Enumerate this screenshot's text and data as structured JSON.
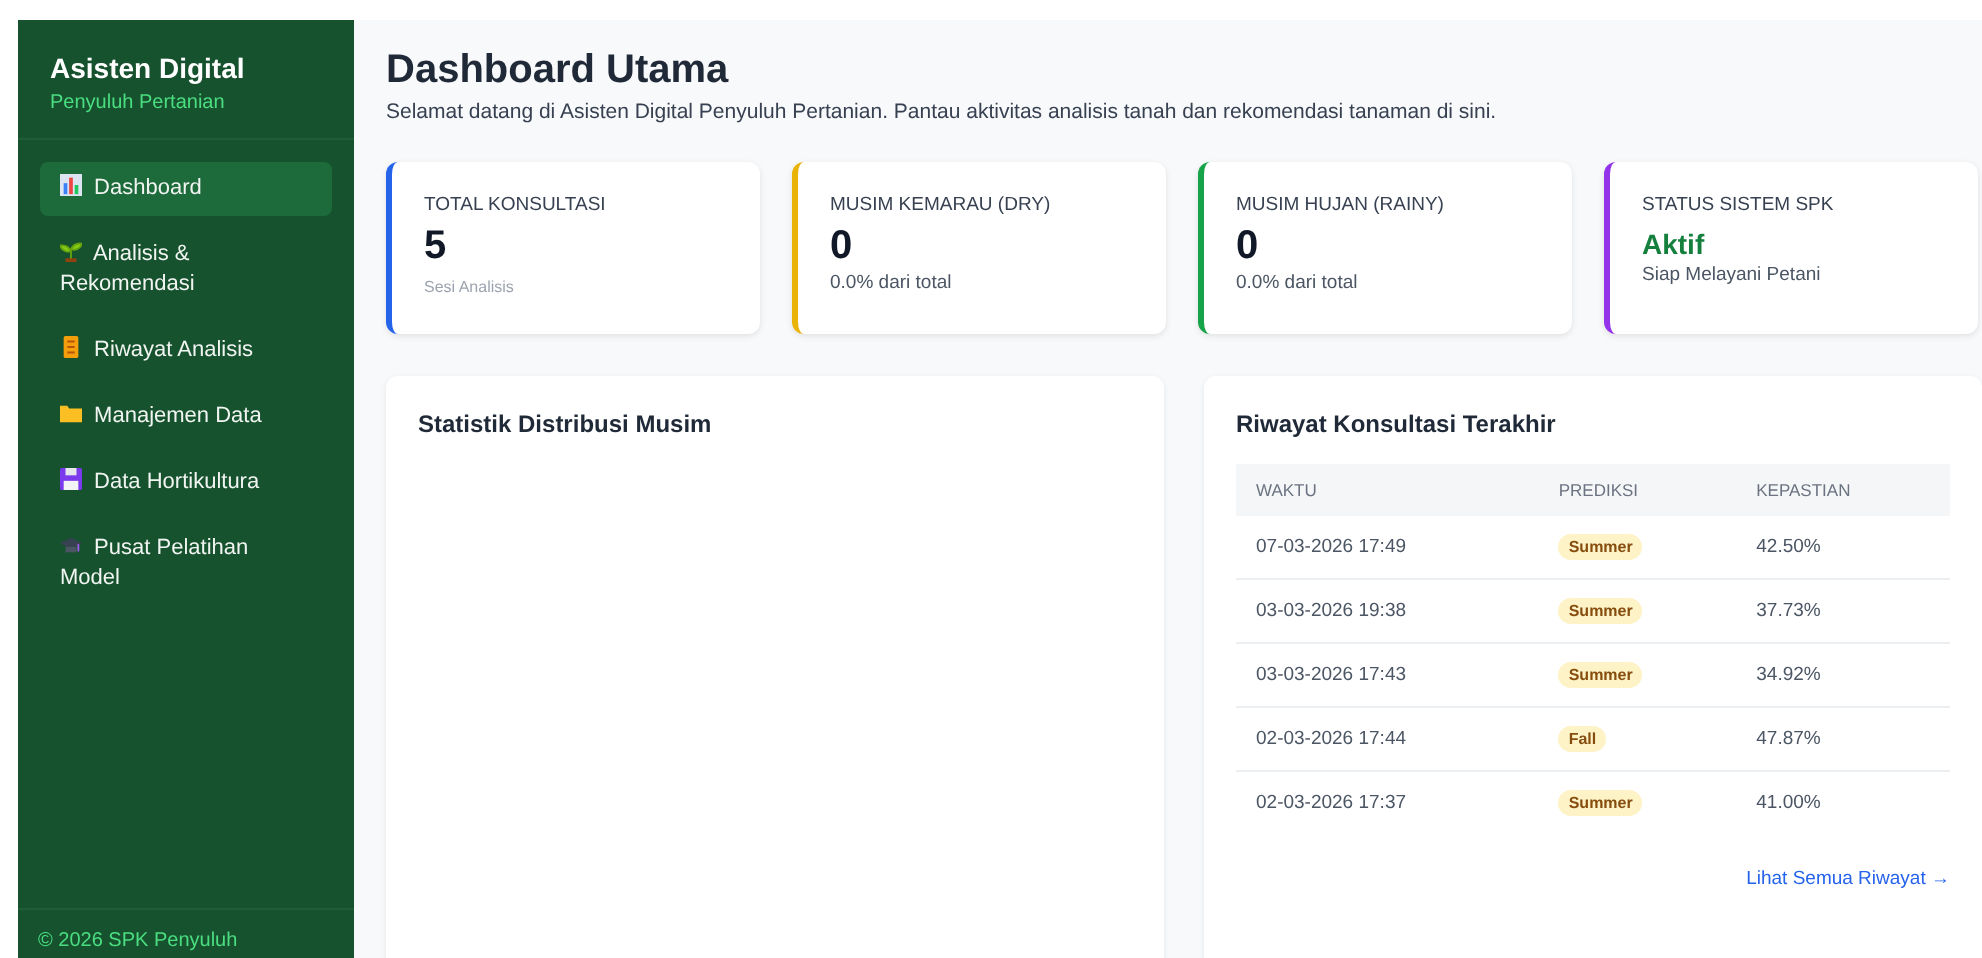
{
  "sidebar": {
    "title": "Asisten Digital",
    "subtitle": "Penyuluh Pertanian",
    "items": [
      {
        "label": "Dashboard",
        "kind": "chart",
        "selected": true
      },
      {
        "label": "Analisis & Rekomendasi",
        "kind": "sprout",
        "selected": false
      },
      {
        "label": "Riwayat Analisis",
        "kind": "scroll",
        "selected": false
      },
      {
        "label": "Manajemen Data",
        "kind": "folder",
        "selected": false
      },
      {
        "label": "Data Hortikultura",
        "kind": "disk",
        "selected": false
      },
      {
        "label": "Pusat Pelatihan Model",
        "kind": "cap",
        "selected": false
      }
    ],
    "footer": "© 2026 SPK Penyuluh"
  },
  "header": {
    "title": "Dashboard Utama",
    "subtitle": "Selamat datang di Asisten Digital Penyuluh Pertanian. Pantau aktivitas analisis tanah dan rekomendasi tanaman di sini."
  },
  "stats": [
    {
      "kind": "number",
      "label": "TOTAL KONSULTASI",
      "value": "5",
      "note": "Sesi Analisis",
      "color": "#2563eb"
    },
    {
      "kind": "number",
      "label": "MUSIM KEMARAU (DRY)",
      "value": "0",
      "note": "0.0% dari total",
      "color": "#eab308"
    },
    {
      "kind": "number",
      "label": "MUSIM HUJAN (RAINY)",
      "value": "0",
      "note": "0.0% dari total",
      "color": "#16a34a"
    },
    {
      "kind": "status",
      "label": "STATUS SISTEM SPK",
      "value": "Aktif",
      "note": "Siap Melayani Petani",
      "color": "#9333ea"
    }
  ],
  "chart_panel": {
    "title": "Statistik Distribusi Musim"
  },
  "history": {
    "title": "Riwayat Konsultasi Terakhir",
    "columns": [
      "WAKTU",
      "PREDIKSI",
      "KEPASTIAN"
    ],
    "rows": [
      {
        "time": "07-03-2026 17:49",
        "prediction": "Summer",
        "certainty": "42.50%"
      },
      {
        "time": "03-03-2026 19:38",
        "prediction": "Summer",
        "certainty": "37.73%"
      },
      {
        "time": "03-03-2026 17:43",
        "prediction": "Summer",
        "certainty": "34.92%"
      },
      {
        "time": "02-03-2026 17:44",
        "prediction": "Fall",
        "certainty": "47.87%"
      },
      {
        "time": "02-03-2026 17:37",
        "prediction": "Summer",
        "certainty": "41.00%"
      }
    ],
    "link": "Lihat Semua Riwayat →"
  }
}
